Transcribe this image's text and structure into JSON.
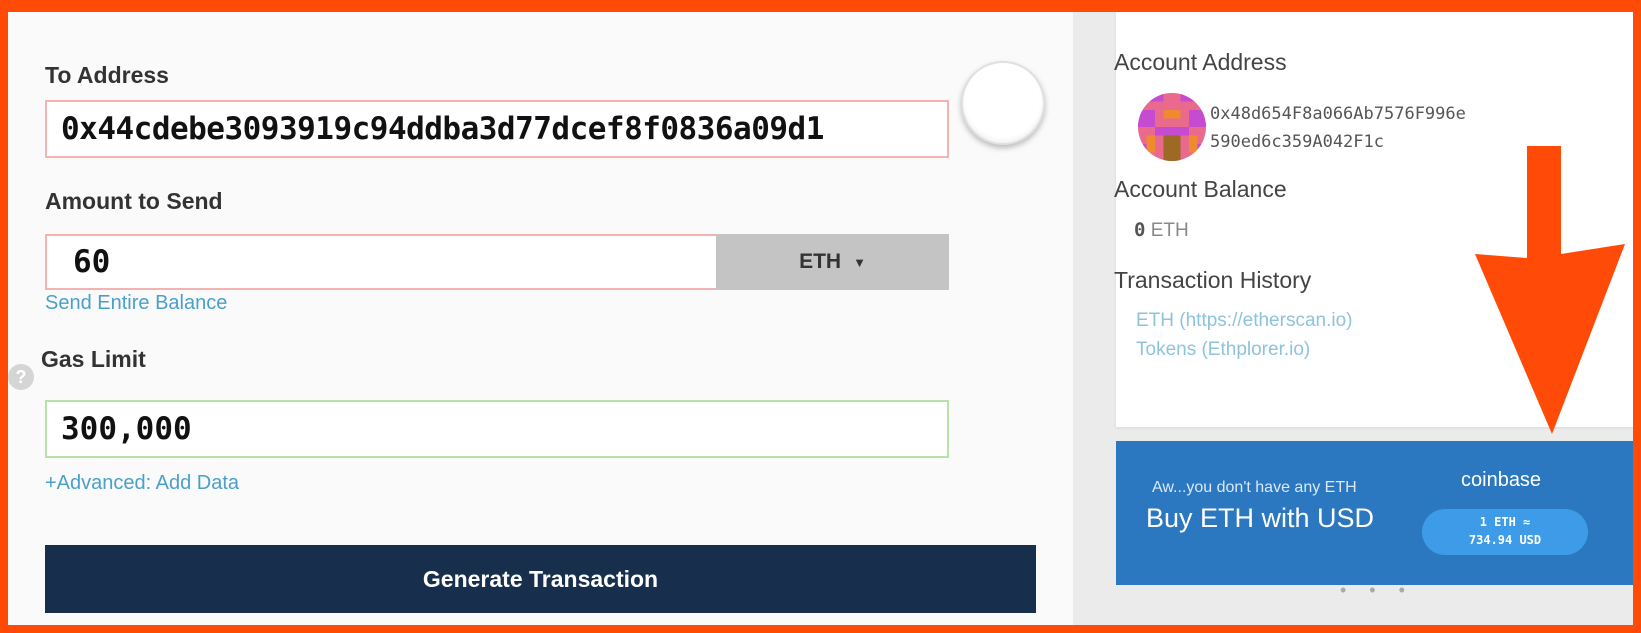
{
  "form": {
    "to_address_label": "To Address",
    "to_address_value": "0x44cdebe3093919c94ddba3d77dcef8f0836a09d1",
    "amount_label": "Amount to Send",
    "amount_value": "60",
    "currency": "ETH",
    "send_entire_balance": "Send Entire Balance",
    "gas_help": "?",
    "gas_limit_label": "Gas Limit",
    "gas_limit_value": "300,000",
    "advanced_link": "+Advanced: Add Data",
    "generate_button": "Generate Transaction"
  },
  "account": {
    "address_heading": "Account Address",
    "address_line1": "0x48d654F8a066Ab7576F996e",
    "address_line2": "590ed6c359A042F1c",
    "balance_heading": "Account Balance",
    "balance_amount": "0",
    "balance_unit": "ETH",
    "history_heading": "Transaction History",
    "history_eth": "ETH (https://etherscan.io)",
    "history_tokens": "Tokens (Ethplorer.io)"
  },
  "coinbase": {
    "note": "Aw...you don't have any ETH",
    "title": "Buy ETH with USD",
    "logo": "coinbase",
    "rate_line1": "1 ETH ≈",
    "rate_line2": "734.94 USD"
  },
  "carousel_dots": "• • •",
  "colors": {
    "frame": "#ff4a08",
    "arrow": "#ff4a08",
    "generate_button": "#172e4d",
    "coinbase_bg": "#2b78c0",
    "link": "#4aa0c8"
  }
}
